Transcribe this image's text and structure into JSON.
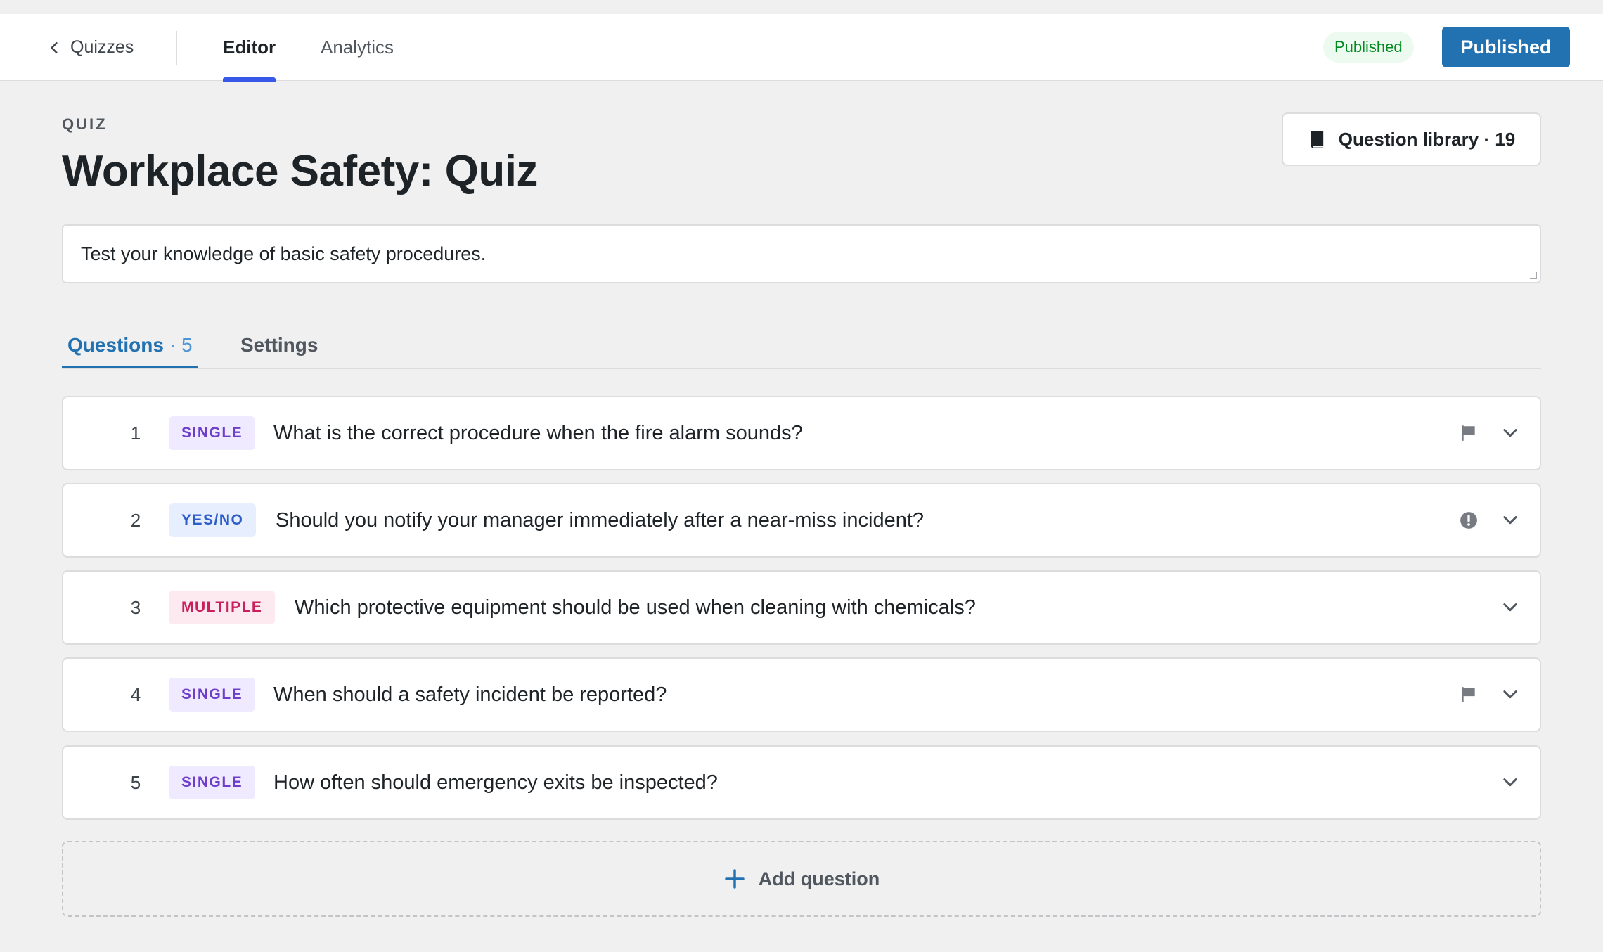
{
  "topbar": {
    "back_label": "Quizzes",
    "tabs": [
      {
        "label": "Editor",
        "active": true
      },
      {
        "label": "Analytics",
        "active": false
      }
    ],
    "status_pill": "Published",
    "publish_button": "Published"
  },
  "header": {
    "eyebrow": "QUIZ",
    "title": "Workplace Safety: Quiz",
    "library_button": "Question library · 19"
  },
  "description": "Test your knowledge of basic safety procedures.",
  "tabs": {
    "questions_label": "Questions",
    "questions_count": "· 5",
    "settings_label": "Settings"
  },
  "questions": [
    {
      "number": "1",
      "type": "SINGLE",
      "text": "What is the correct procedure when the fire alarm sounds?",
      "indicator": "flag-icon"
    },
    {
      "number": "2",
      "type": "YES/NO",
      "text": "Should you notify your manager immediately after a near-miss incident?",
      "indicator": "alert-icon"
    },
    {
      "number": "3",
      "type": "MULTIPLE",
      "text": "Which protective equipment should be used when cleaning with chemicals?",
      "indicator": ""
    },
    {
      "number": "4",
      "type": "SINGLE",
      "text": "When should a safety incident be reported?",
      "indicator": "flag-icon"
    },
    {
      "number": "5",
      "type": "SINGLE",
      "text": "How often should emergency exits be inspected?",
      "indicator": ""
    }
  ],
  "add_question_label": "Add question",
  "colors": {
    "accent": "#2271b1",
    "editor_underline": "#3858e9",
    "published_green": "#008a20"
  }
}
